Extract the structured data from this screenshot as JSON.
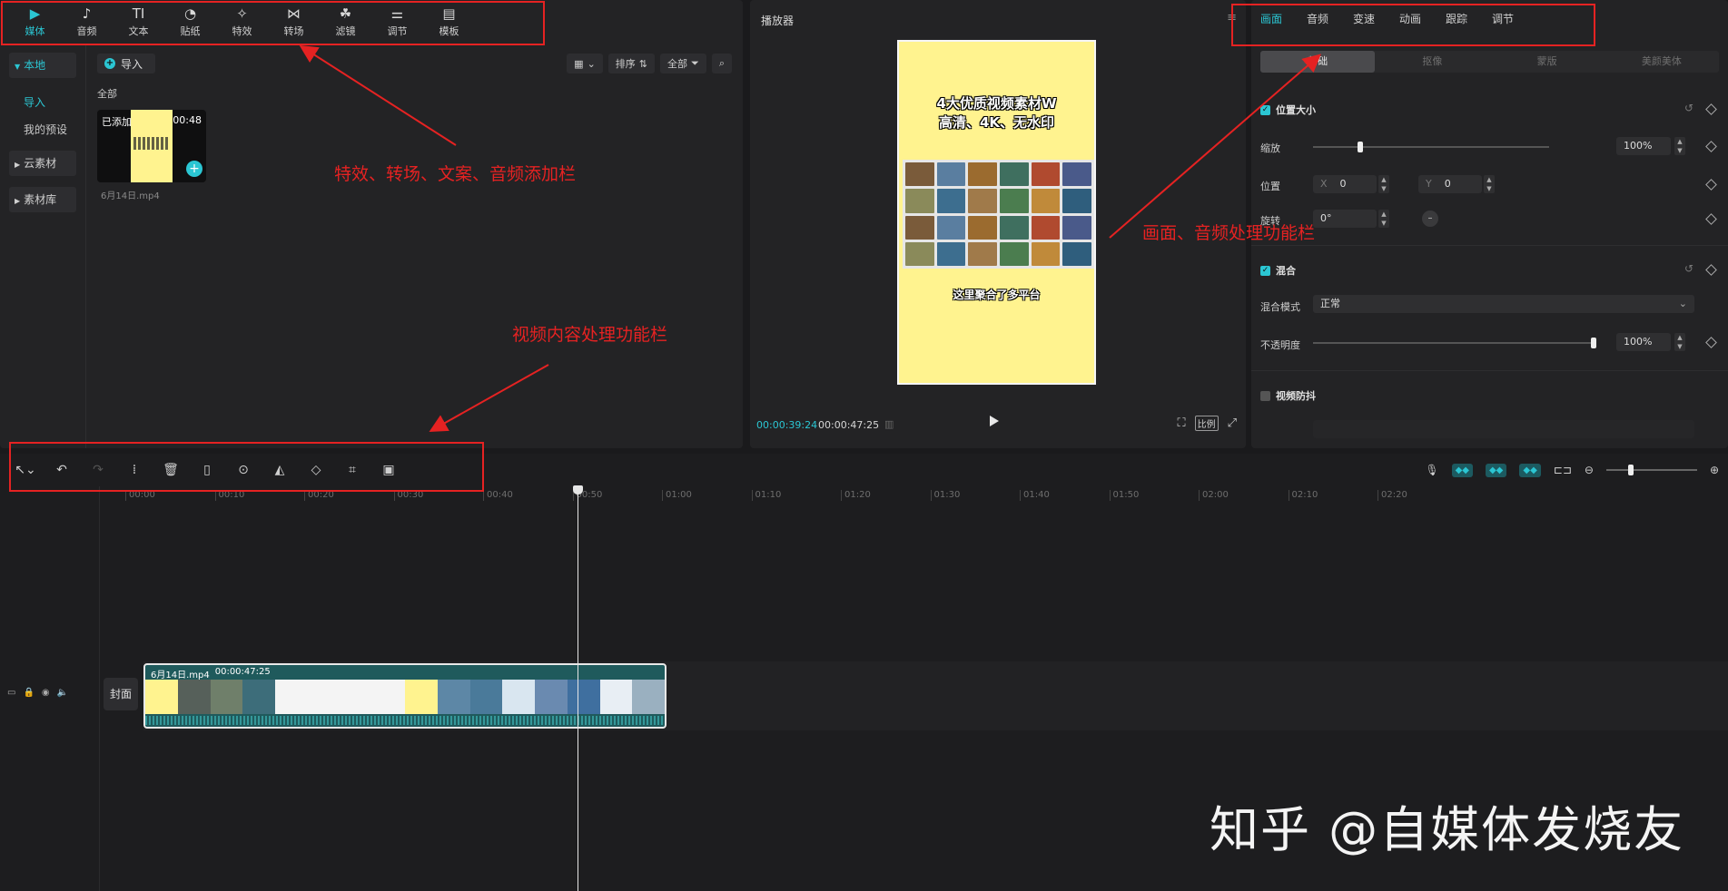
{
  "media": {
    "tabs": [
      {
        "label": "媒体",
        "icon": "media-icon",
        "glyph": "▶"
      },
      {
        "label": "音频",
        "icon": "audio-icon",
        "glyph": "♪"
      },
      {
        "label": "文本",
        "icon": "text-icon",
        "glyph": "TI"
      },
      {
        "label": "贴纸",
        "icon": "sticker-icon",
        "glyph": "◔"
      },
      {
        "label": "特效",
        "icon": "effects-icon",
        "glyph": "✧"
      },
      {
        "label": "转场",
        "icon": "transition-icon",
        "glyph": "⋈"
      },
      {
        "label": "滤镜",
        "icon": "filter-icon",
        "glyph": "☘"
      },
      {
        "label": "调节",
        "icon": "adjust-icon",
        "glyph": "⚌"
      },
      {
        "label": "模板",
        "icon": "template-icon",
        "glyph": "▤"
      }
    ],
    "sidebar": {
      "local": "本地",
      "import": "导入",
      "presets": "我的预设",
      "cloud": "云素材",
      "library": "素材库"
    },
    "import_button": "导入",
    "sort_label": "排序",
    "filter_label": "全部",
    "all_label": "全部",
    "clip": {
      "added": "已添加",
      "duration": "00:48",
      "name": "6月14日.mp4"
    }
  },
  "player": {
    "title": "播放器",
    "current_time": "00:00:39:24",
    "total_time": "00:00:47:25",
    "ratio_label": "比例",
    "frame_title_line1": "4大优质视频素材W",
    "frame_title_line2": "高清、4K、无水印",
    "frame_subtitle": "这里聚合了多平台"
  },
  "inspector": {
    "tabs": [
      "画面",
      "音频",
      "变速",
      "动画",
      "跟踪",
      "调节"
    ],
    "sub_tabs": [
      "基础",
      "抠像",
      "蒙版",
      "美颜美体"
    ],
    "position_size": "位置大小",
    "scale_label": "缩放",
    "scale_value": "100%",
    "scale_level": 0.2,
    "position_label": "位置",
    "pos_x_prefix": "X",
    "pos_x": "0",
    "pos_y_prefix": "Y",
    "pos_y": "0",
    "rotate_label": "旋转",
    "rotate_value": "0°",
    "blend_label": "混合",
    "blend_mode_label": "混合模式",
    "blend_mode_value": "正常",
    "opacity_label": "不透明度",
    "opacity_value": "100%",
    "opacity_level": 1.0,
    "stabilize_label": "视频防抖"
  },
  "timeline": {
    "ticks": [
      "00:00",
      "00:10",
      "00:20",
      "00:30",
      "00:40",
      "00:50",
      "01:00",
      "01:10",
      "01:20",
      "01:30",
      "01:40",
      "01:50",
      "02:00",
      "02:10",
      "02:20"
    ],
    "cover_label": "封面",
    "clip_name": "6月14日.mp4",
    "clip_duration": "00:00:47:25"
  },
  "annotations": {
    "top_bar": "特效、转场、文案、音频添加栏",
    "inspector": "画面、音频处理功能栏",
    "timeline_tools": "视频内容处理功能栏"
  },
  "watermark": "知乎 @自媒体发烧友",
  "colors": {
    "accent": "#2bc6d3",
    "annotation": "#e52222",
    "frame": "#fff38f"
  }
}
